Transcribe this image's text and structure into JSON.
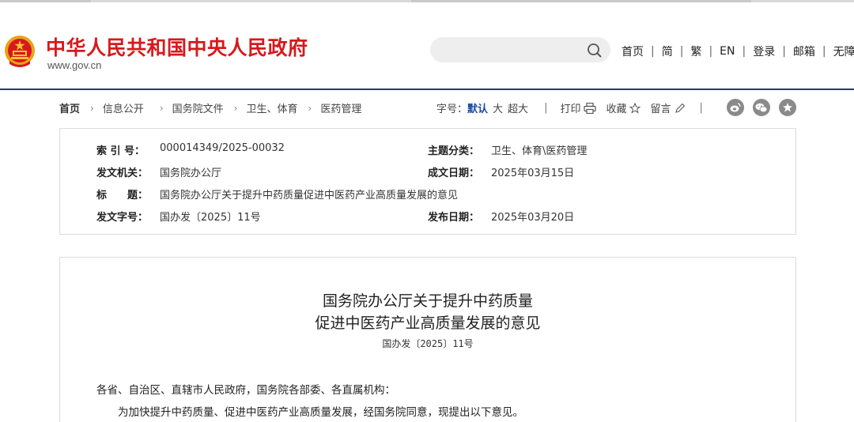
{
  "header": {
    "site_title": "中华人民共和国中央人民政府",
    "site_url": "www.gov.cn",
    "search_placeholder": "",
    "nav": [
      "首页",
      "简",
      "繁",
      "EN",
      "登录",
      "邮箱",
      "无障碍"
    ]
  },
  "breadcrumb": {
    "home": "首页",
    "items": [
      "信息公开",
      "国务院文件",
      "卫生、体育",
      "医药管理"
    ]
  },
  "tools": {
    "font_size_label": "字号：",
    "font_sizes": [
      "默认",
      "大",
      "超大"
    ],
    "print": "打印",
    "favorite": "收藏",
    "comment": "留言"
  },
  "share_icons": [
    "weibo-icon",
    "wechat-icon",
    "star-icon"
  ],
  "info": {
    "index_label": "索 引 号：",
    "index_value": "000014349/2025-00032",
    "topic_label": "主题分类：",
    "topic_value": "卫生、体育\\医药管理",
    "issuer_label": "发文机关：",
    "issuer_value": "国务院办公厅",
    "date_written_label": "成文日期：",
    "date_written_value": "2025年03月15日",
    "title_label": "标　　题：",
    "title_value": "国务院办公厅关于提升中药质量促进中医药产业高质量发展的意见",
    "doc_no_label": "发文字号：",
    "doc_no_value": "国办发〔2025〕11号",
    "publish_date_label": "发布日期：",
    "publish_date_value": "2025年03月20日"
  },
  "article": {
    "title_line1": "国务院办公厅关于提升中药质量",
    "title_line2": "促进中医药产业高质量发展的意见",
    "doc_no": "国办发〔2025〕11号",
    "salutation": "各省、自治区、直辖市人民政府，国务院各部委、各直属机构：",
    "paragraph1": "为加快提升中药质量、促进中医药产业高质量发展，经国务院同意，现提出以下意见。"
  },
  "colors": {
    "title_red": "#d7191c",
    "rule_navy": "#1f3d6e",
    "active_blue": "#1a4aa0"
  }
}
